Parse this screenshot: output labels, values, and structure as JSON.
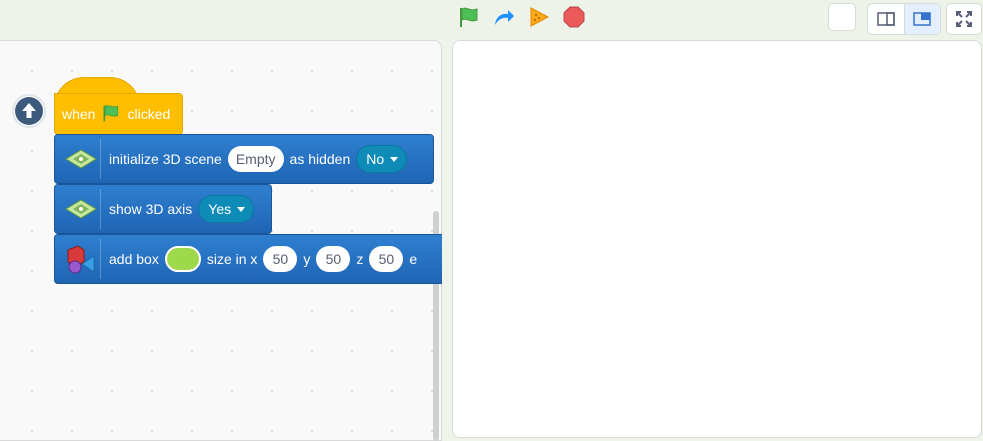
{
  "toolbar": {
    "icons": [
      "green-flag-icon",
      "turbo-icon",
      "cone-icon",
      "stop-sign-icon"
    ],
    "stage_modes": [
      "small-stage-icon",
      "large-stage-icon"
    ],
    "fullscreen_icon": "fullscreen-icon"
  },
  "blocks": {
    "hat": {
      "before": "when",
      "after": "clicked"
    },
    "init": {
      "label": "initialize 3D scene",
      "scene_value": "Empty",
      "hidden_label": "as hidden",
      "hidden_value": "No"
    },
    "axis": {
      "label": "show 3D axis",
      "value": "Yes"
    },
    "box": {
      "label": "add box",
      "size_label": "size in x",
      "x": "50",
      "y_label": "y",
      "y": "50",
      "z_label": "z",
      "z": "50",
      "tail": "e",
      "color": "#9ed94b"
    }
  },
  "colors": {
    "hat": "#ffbf00",
    "command": "#1f65b4",
    "dropdown": "#0f8bb8"
  }
}
